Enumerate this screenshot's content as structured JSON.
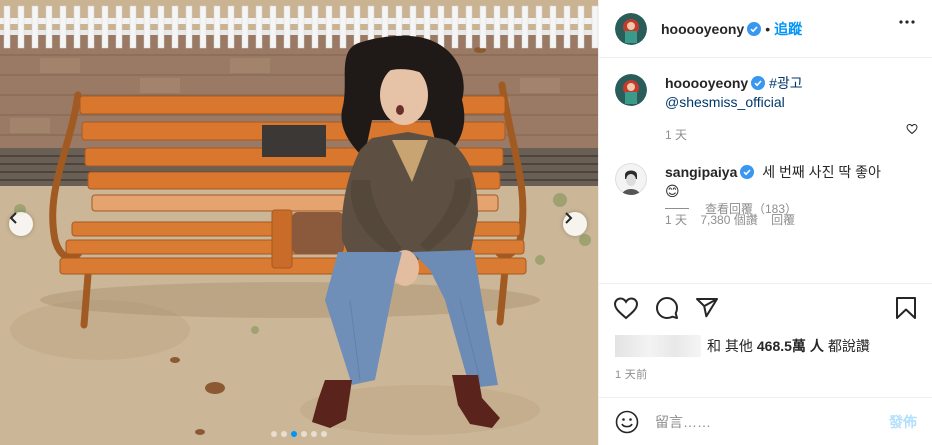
{
  "post": {
    "username": "hooooyeony",
    "header_separator": "•",
    "follow_label": "追蹤",
    "caption": {
      "username": "hooooyeony",
      "hashtag": "#광고",
      "mention": "@shesmiss_official",
      "time": "1 天"
    },
    "comment": {
      "username": "sangipaiya",
      "text": "세 번째 사진 딱 좋아",
      "emoji": "😊",
      "time": "1 天",
      "likes": "7,380 個讚",
      "reply_label": "回覆"
    },
    "view_replies_label": "查看回覆（183）",
    "likes_text": "和 其他",
    "likes_count": "468.5萬 人",
    "likes_suffix": "都說讚",
    "time_ago": "1 天前",
    "comment_placeholder": "留言……",
    "post_button": "發佈",
    "carousel": {
      "total": 6,
      "active": 2
    }
  },
  "icons": {
    "verified": "verified-badge-icon",
    "more": "more-options-icon",
    "like": "heart-icon",
    "comment": "comment-icon",
    "share": "share-icon",
    "save": "bookmark-icon",
    "emoji": "emoji-icon",
    "prev": "chevron-left-icon",
    "next": "chevron-right-icon"
  },
  "colors": {
    "accent": "#0095f6",
    "verified": "#3897f0",
    "muted": "#8e8e8e",
    "post_disabled": "#b2dffc",
    "bench": "#d9772e"
  }
}
